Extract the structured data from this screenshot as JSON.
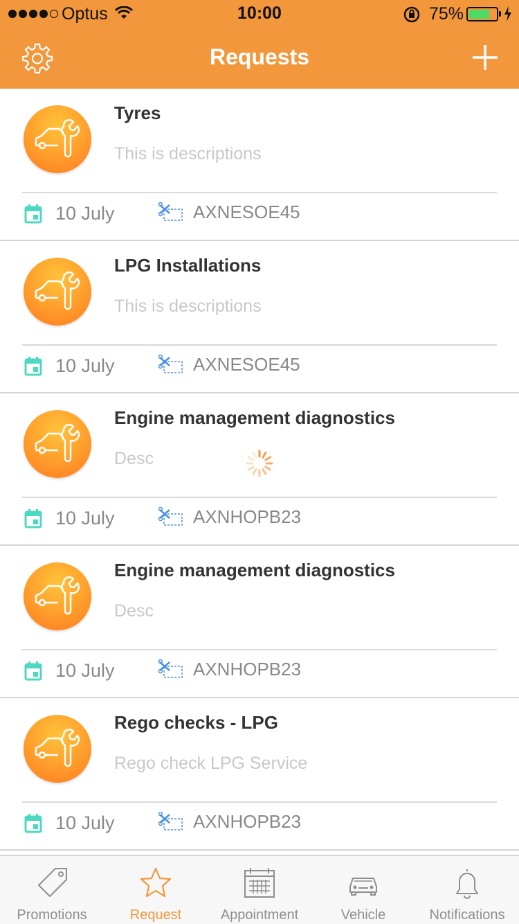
{
  "status_bar": {
    "carrier": "Optus",
    "time": "10:00",
    "battery_percent": "75%",
    "battery_level": 0.75
  },
  "header": {
    "title": "Requests",
    "settings_icon": "gear-icon",
    "add_icon": "plus-icon"
  },
  "requests": [
    {
      "title": "Tyres",
      "description": "This is descriptions",
      "date": "10 July",
      "code": "AXNESOE45"
    },
    {
      "title": "LPG Installations",
      "description": "This is descriptions",
      "date": "10 July",
      "code": "AXNESOE45"
    },
    {
      "title": "Engine management diagnostics",
      "description": "Desc",
      "date": "10 July",
      "code": "AXNHOPB23"
    },
    {
      "title": "Engine management diagnostics",
      "description": "Desc",
      "date": "10 July",
      "code": "AXNHOPB23"
    },
    {
      "title": "Rego checks - LPG",
      "description": "Rego check LPG Service",
      "date": "10 July",
      "code": "AXNHOPB23"
    }
  ],
  "tabs": [
    {
      "label": "Promotions",
      "icon": "tag-icon"
    },
    {
      "label": "Request",
      "icon": "star-icon",
      "active": true
    },
    {
      "label": "Appointment",
      "icon": "calendar-icon"
    },
    {
      "label": "Vehicle",
      "icon": "car-icon"
    },
    {
      "label": "Notifications",
      "icon": "bell-icon"
    }
  ],
  "colors": {
    "accent": "#F2973B",
    "calendar_icon": "#4CD9C0",
    "coupon_icon": "#4A90E2"
  }
}
